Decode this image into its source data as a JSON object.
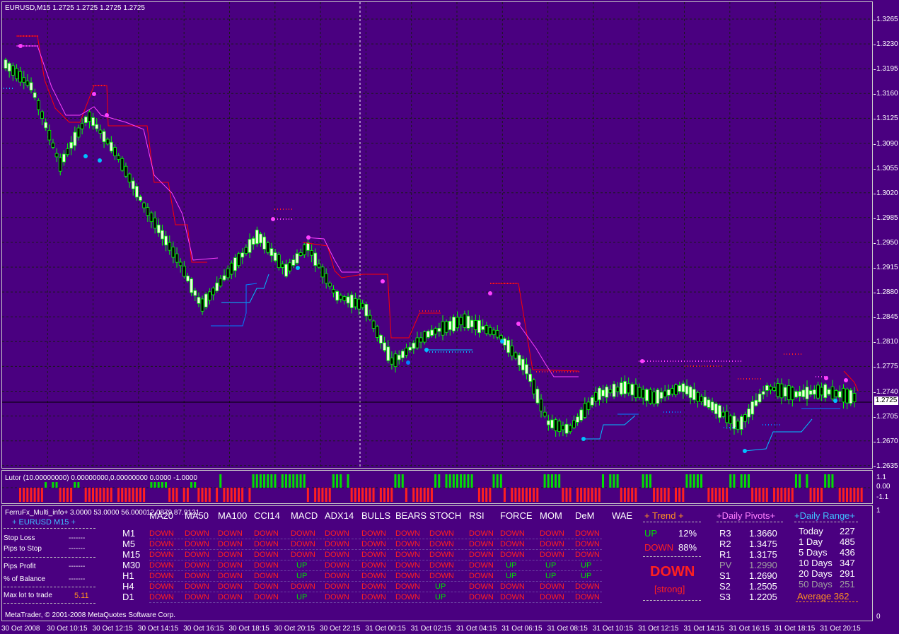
{
  "window": {
    "symbol_header": "EURUSD,M15  1.2725 1.2725 1.2725 1.2725",
    "copyright": "MetaTrader, © 2001-2008 MetaQuotes Software Corp.",
    "info_indicator_header": "FerruFx_Multi_info+ 3.0000 53.0000 56.0000",
    "info_indicator_values": "12.0879 87.9121",
    "lutor_header": "Lutor (10.00000000) 0.00000000,0.00000000 0.0000 -1.0000"
  },
  "colors": {
    "background": "#4a0080",
    "bull_candle": "#f0f8e0",
    "bear_candle": "#00ff00",
    "up_green": "#00e000",
    "down_red": "#ff2020",
    "ma_red": "#ff0000",
    "ma_magenta": "#ff40ff",
    "support_blue": "#0080ff",
    "support_cyan": "#00c0ff",
    "accent_orange": "#ff9020",
    "pivot_header": "#ff80ff",
    "range_header": "#40c0ff"
  },
  "price_axis": {
    "labels": [
      "1.3265",
      "1.3230",
      "1.3195",
      "1.3160",
      "1.3125",
      "1.3090",
      "1.3055",
      "1.3020",
      "1.2985",
      "1.2950",
      "1.2915",
      "1.2880",
      "1.2845",
      "1.2810",
      "1.2775",
      "1.2740",
      "1.2705",
      "1.2670",
      "1.2635"
    ],
    "current_price": "1.2725"
  },
  "lutor_axis": {
    "labels": [
      "1.1",
      "0.00",
      "-1.1"
    ]
  },
  "info_axis": {
    "labels": [
      "1",
      "0"
    ]
  },
  "time_axis": {
    "labels": [
      "30 Oct 2008",
      "30 Oct 10:15",
      "30 Oct 12:15",
      "30 Oct 14:15",
      "30 Oct 16:15",
      "30 Oct 18:15",
      "30 Oct 20:15",
      "30 Oct 22:15",
      "31 Oct 00:15",
      "31 Oct 02:15",
      "31 Oct 04:15",
      "31 Oct 06:15",
      "31 Oct 08:15",
      "31 Oct 10:15",
      "31 Oct 12:15",
      "31 Oct 14:15",
      "31 Oct 16:15",
      "31 Oct 18:15",
      "31 Oct 20:15"
    ]
  },
  "left_panel": {
    "symbol_line": "+ EURUSD M15 +",
    "stop_loss_label": "Stop Loss",
    "stop_loss_value": "-------",
    "pips_to_stop_label": "Pips to Stop",
    "pips_to_stop_value": "-------",
    "pips_profit_label": "Pips Profit",
    "pips_profit_value": "-------",
    "balance_label": "% of Balance",
    "balance_value": "-------",
    "max_lot_label": "Max lot to trade",
    "max_lot_value": "5.11"
  },
  "matrix": {
    "columns": [
      "MA20",
      "MA50",
      "MA100",
      "CCI14",
      "MACD",
      "ADX14",
      "BULLS",
      "BEARS",
      "STOCH",
      "RSI",
      "FORCE",
      "MOM",
      "DeM",
      "WAE"
    ],
    "rows": [
      {
        "tf": "M1",
        "cells": [
          "DOWN",
          "DOWN",
          "DOWN",
          "DOWN",
          "DOWN",
          "DOWN",
          "DOWN",
          "DOWN",
          "DOWN",
          "DOWN",
          "DOWN",
          "DOWN",
          "DOWN"
        ]
      },
      {
        "tf": "M5",
        "cells": [
          "DOWN",
          "DOWN",
          "DOWN",
          "DOWN",
          "DOWN",
          "DOWN",
          "DOWN",
          "DOWN",
          "DOWN",
          "DOWN",
          "DOWN",
          "DOWN",
          "DOWN"
        ]
      },
      {
        "tf": "M15",
        "cells": [
          "DOWN",
          "DOWN",
          "DOWN",
          "DOWN",
          "DOWN",
          "DOWN",
          "DOWN",
          "DOWN",
          "DOWN",
          "DOWN",
          "DOWN",
          "DOWN",
          "DOWN"
        ]
      },
      {
        "tf": "M30",
        "cells": [
          "DOWN",
          "DOWN",
          "DOWN",
          "DOWN",
          "UP",
          "DOWN",
          "DOWN",
          "DOWN",
          "DOWN",
          "DOWN",
          "UP",
          "UP",
          "UP"
        ]
      },
      {
        "tf": "H1",
        "cells": [
          "DOWN",
          "DOWN",
          "DOWN",
          "DOWN",
          "UP",
          "DOWN",
          "DOWN",
          "DOWN",
          "DOWN",
          "DOWN",
          "UP",
          "UP",
          "UP"
        ]
      },
      {
        "tf": "H4",
        "cells": [
          "DOWN",
          "DOWN",
          "DOWN",
          "DOWN",
          "DOWN",
          "DOWN",
          "DOWN",
          "DOWN",
          "UP",
          "DOWN",
          "DOWN",
          "DOWN",
          "DOWN"
        ]
      },
      {
        "tf": "D1",
        "cells": [
          "DOWN",
          "DOWN",
          "DOWN",
          "DOWN",
          "UP",
          "DOWN",
          "DOWN",
          "DOWN",
          "UP",
          "DOWN",
          "DOWN",
          "DOWN",
          "DOWN"
        ]
      }
    ]
  },
  "trend": {
    "header": "+   Trend   +",
    "up_label": "UP",
    "up_pct": "12%",
    "down_label": "DOWN",
    "down_pct": "88%",
    "signal": "DOWN",
    "strength": "[strong]"
  },
  "pivots": {
    "header": "+Daily Pivots+",
    "items": [
      {
        "name": "R3",
        "value": "1.3660"
      },
      {
        "name": "R2",
        "value": "1.3475"
      },
      {
        "name": "R1",
        "value": "1.3175"
      },
      {
        "name": "PV",
        "value": "1.2990"
      },
      {
        "name": "S1",
        "value": "1.2690"
      },
      {
        "name": "S2",
        "value": "1.2505"
      },
      {
        "name": "S3",
        "value": "1.2205"
      }
    ]
  },
  "daily_range": {
    "header": "+Daily Range+",
    "items": [
      {
        "name": "Today",
        "value": "227"
      },
      {
        "name": "1 Day",
        "value": "485"
      },
      {
        "name": "5 Days",
        "value": "436"
      },
      {
        "name": "10 Days",
        "value": "347"
      },
      {
        "name": "20 Days",
        "value": "291"
      },
      {
        "name": "50 Days",
        "value": "251"
      }
    ],
    "average": "Average  362"
  }
}
